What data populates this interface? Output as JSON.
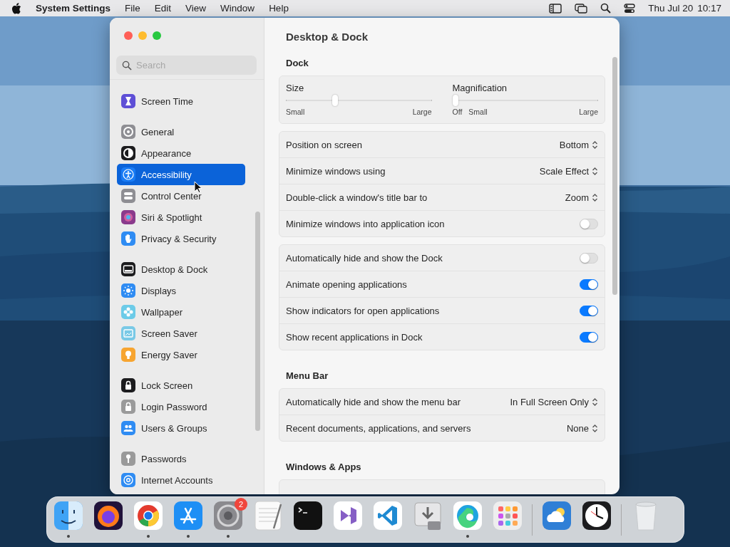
{
  "menu_bar": {
    "app": "System Settings",
    "menus": [
      "File",
      "Edit",
      "View",
      "Window",
      "Help"
    ],
    "date": "Thu Jul 20",
    "time": "10:17"
  },
  "window": {
    "controls": [
      {
        "color": "#ff5f57"
      },
      {
        "color": "#febc2e"
      },
      {
        "color": "#28c840"
      }
    ],
    "title": "Desktop & Dock"
  },
  "sidebar": {
    "search": {
      "placeholder": "Search"
    },
    "groups": [
      [
        {
          "label": "Screen Time",
          "kind": "hourglass",
          "color": "#5e4fd6",
          "selected": false
        }
      ],
      [
        {
          "label": "General",
          "kind": "gear",
          "color": "#8e8e93",
          "selected": false
        },
        {
          "label": "Appearance",
          "kind": "contrast",
          "color": "#1c1c1e",
          "selected": false
        },
        {
          "label": "Accessibility",
          "kind": "person",
          "color": "#1a7cf5",
          "selected": true
        },
        {
          "label": "Control Center",
          "kind": "toggles",
          "color": "#8e8e93",
          "selected": false
        },
        {
          "label": "Siri & Spotlight",
          "kind": "orb",
          "color": "#8a3a8c",
          "selected": false
        },
        {
          "label": "Privacy & Security",
          "kind": "hand",
          "color": "#2f8cf3",
          "selected": false
        }
      ],
      [
        {
          "label": "Desktop & Dock",
          "kind": "dock",
          "color": "#1c1c1e",
          "selected": false
        },
        {
          "label": "Displays",
          "kind": "sun",
          "color": "#2f8cf3",
          "selected": false
        },
        {
          "label": "Wallpaper",
          "kind": "flower",
          "color": "#6ccbe8",
          "selected": false
        },
        {
          "label": "Screen Saver",
          "kind": "screen",
          "color": "#79c9e6",
          "selected": false
        },
        {
          "label": "Energy Saver",
          "kind": "bulb",
          "color": "#f7a531",
          "selected": false
        }
      ],
      [
        {
          "label": "Lock Screen",
          "kind": "lock",
          "color": "#1c1c1e",
          "selected": false
        },
        {
          "label": "Login Password",
          "kind": "lock",
          "color": "#9a9a9a",
          "selected": false
        },
        {
          "label": "Users & Groups",
          "kind": "people",
          "color": "#2f8cf3",
          "selected": false
        }
      ],
      [
        {
          "label": "Passwords",
          "kind": "key",
          "color": "#9a9a9a",
          "selected": false
        },
        {
          "label": "Internet Accounts",
          "kind": "at",
          "color": "#2f8cf3",
          "selected": false
        }
      ]
    ]
  },
  "sections": [
    {
      "heading": "Dock",
      "cards": [
        {
          "kind": "sliders",
          "sliders": [
            {
              "label": "Size",
              "level": 0.33,
              "marks": [
                "Small",
                "Large"
              ]
            },
            {
              "label": "Magnification",
              "level": 0,
              "marks": [
                "Off",
                "Small",
                "Large"
              ]
            }
          ]
        },
        {
          "kind": "rows",
          "rows": [
            {
              "kind": "popup",
              "label": "Position on screen",
              "value": "Bottom"
            },
            {
              "kind": "popup",
              "label": "Minimize windows using",
              "value": "Scale Effect"
            },
            {
              "kind": "popup",
              "label": "Double-click a window's title bar to",
              "value": "Zoom"
            },
            {
              "kind": "toggle",
              "label": "Minimize windows into application icon",
              "on": false
            }
          ]
        },
        {
          "kind": "rows",
          "rows": [
            {
              "kind": "toggle",
              "label": "Automatically hide and show the Dock",
              "on": false
            },
            {
              "kind": "toggle",
              "label": "Animate opening applications",
              "on": true
            },
            {
              "kind": "toggle",
              "label": "Show indicators for open applications",
              "on": true
            },
            {
              "kind": "toggle",
              "label": "Show recent applications in Dock",
              "on": true
            }
          ]
        }
      ]
    },
    {
      "heading": "Menu Bar",
      "cards": [
        {
          "kind": "rows",
          "rows": [
            {
              "kind": "popup",
              "label": "Automatically hide and show the menu bar",
              "value": "In Full Screen Only"
            },
            {
              "kind": "popup",
              "label": "Recent documents, applications, and servers",
              "value": "None"
            }
          ]
        }
      ]
    },
    {
      "heading": "Windows & Apps",
      "cards": [
        {
          "kind": "stub"
        }
      ]
    }
  ],
  "dock": {
    "groups": [
      [
        {
          "kind": "finder",
          "running": true
        },
        {
          "kind": "firefox",
          "running": false
        },
        {
          "kind": "chrome",
          "running": true
        },
        {
          "kind": "appstore",
          "running": true
        },
        {
          "kind": "settings",
          "running": true,
          "badge": "2"
        },
        {
          "kind": "textedit",
          "running": false
        },
        {
          "kind": "terminal",
          "running": false
        },
        {
          "kind": "vs",
          "running": false
        },
        {
          "kind": "vscode",
          "running": false
        },
        {
          "kind": "installer",
          "running": false
        },
        {
          "kind": "edge",
          "running": true
        },
        {
          "kind": "launchpad",
          "running": false
        }
      ],
      [
        {
          "kind": "weather",
          "running": false
        },
        {
          "kind": "clock",
          "running": false
        }
      ],
      [
        {
          "kind": "trash",
          "running": false
        }
      ]
    ]
  }
}
